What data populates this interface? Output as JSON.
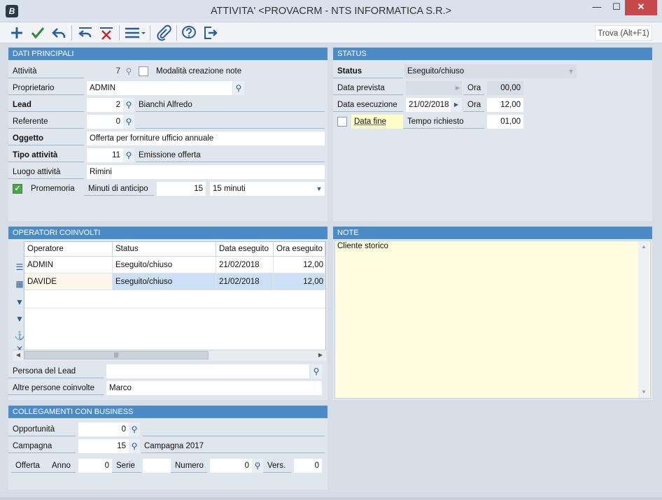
{
  "window": {
    "app_icon": "B",
    "title": "ATTIVITA' <PROVACRM - NTS INFORMATICA S.R.>",
    "minimize_glyph": "—",
    "maximize_glyph": "☐",
    "close_glyph": "✕"
  },
  "toolbar": {
    "icons": [
      "plus-icon",
      "check-icon",
      "back-arrow-icon",
      "undo-icon",
      "delete-icon",
      "menu-icon",
      "attachment-icon",
      "help-icon",
      "exit-icon"
    ],
    "find_label": "Trova (Alt+F1)"
  },
  "dati_principali": {
    "header": "DATI PRINCIPALI",
    "attivita_label": "Attività",
    "attivita_value": "7",
    "modalita_label": "Modalità creazione note",
    "proprietario_label": "Proprietario",
    "proprietario_value": "ADMIN",
    "lead_label": "Lead",
    "lead_value": "2",
    "lead_name": "Bianchi Alfredo",
    "referente_label": "Referente",
    "referente_value": "0",
    "oggetto_label": "Oggetto",
    "oggetto_value": "Offerta per forniture ufficio annuale",
    "tipo_label": "Tipo attività",
    "tipo_value": "11",
    "tipo_desc": "Emissione offerta",
    "luogo_label": "Luogo attività",
    "luogo_value": "Rimini",
    "promemoria_label": "Promemoria",
    "promemoria_checked": true,
    "minuti_label": "Minuti di anticipo",
    "minuti_value": "15",
    "minuti_select": "15 minuti"
  },
  "status": {
    "header": "STATUS",
    "status_label": "Status",
    "status_value": "Eseguito/chiuso",
    "data_prevista_label": "Data prevista",
    "data_prevista_value": "",
    "ora1_label": "Ora",
    "ora1_value": "00,00",
    "data_esecuzione_label": "Data esecuzione",
    "data_esecuzione_value": "21/02/2018",
    "ora2_label": "Ora",
    "ora2_value": "12,00",
    "data_fine_label": "Data fine",
    "tempo_label": "Tempo richiesto",
    "tempo_value": "01,00"
  },
  "operatori": {
    "header": "OPERATORI COINVOLTI",
    "columns": [
      "Operatore",
      "Status",
      "Data eseguito",
      "Ora eseguito"
    ],
    "rows": [
      [
        "ADMIN",
        "Eseguito/chiuso",
        "21/02/2018",
        "12,00"
      ],
      [
        "DAVIDE",
        "Eseguito/chiuso",
        "21/02/2018",
        "12,00"
      ]
    ],
    "side_icons": [
      "list-icon",
      "grid-icon",
      "filter-icon",
      "filter-remove-icon",
      "anchor-icon",
      "close-icon"
    ],
    "scroll_grip": "|||",
    "persona_label": "Persona del Lead",
    "persona_value": "",
    "altre_label": "Altre persone coinvolte",
    "altre_value": "Marco"
  },
  "note": {
    "header": "NOTE",
    "text": "Cliente storico"
  },
  "business": {
    "header": "COLLEGAMENTI CON BUSINESS",
    "opportunita_label": "Opportunità",
    "opportunita_value": "0",
    "campagna_label": "Campagna",
    "campagna_value": "15",
    "campagna_desc": "Campagna 2017",
    "offerta_label": "Offerta",
    "anno_label": "Anno",
    "anno_value": "0",
    "serie_label": "Serie",
    "serie_value": "",
    "numero_label": "Numero",
    "numero_value": "0",
    "vers_label": "Vers.",
    "vers_value": "0"
  },
  "colors": {
    "header_blue": "#4b8cc6",
    "panel_bg": "#dfe6ee",
    "note_bg": "#fefde0",
    "selected_row": "#cce0f5",
    "close_red": "#c74848"
  }
}
